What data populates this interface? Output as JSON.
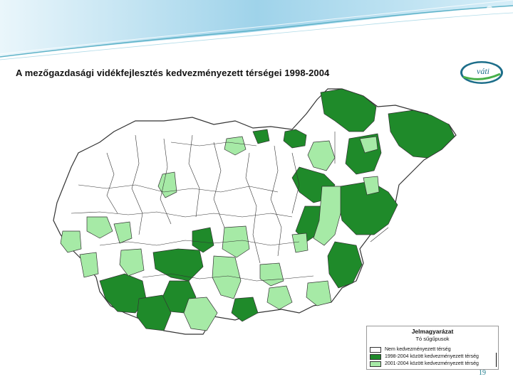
{
  "slide": {
    "title": "A mezőgazdasági vidékfejlesztés kedvezményezett térségei 1998-2004",
    "page_number": "19"
  },
  "logo": {
    "text": "váti",
    "icon": "vati-logo"
  },
  "colors": {
    "not_beneficiary": "#ffffff",
    "beneficiary_1998_2004": "#1f8a2a",
    "beneficiary_2001_2004": "#a6eaa6",
    "border": "#333333",
    "header_blue": "#a9d6ee",
    "header_teal": "#5fb3c8"
  },
  "legend": {
    "title": "Jelmagyarázat",
    "subtitle": "Tó sűgűpusok",
    "items": [
      {
        "label": "Nem kedvezményezett térség",
        "color": "#ffffff"
      },
      {
        "label": "1998-2004 között kedvezményezett térség",
        "color": "#1f8a2a"
      },
      {
        "label": "2001-2004 között kedvezményezett térség",
        "color": "#a6eaa6"
      }
    ]
  }
}
